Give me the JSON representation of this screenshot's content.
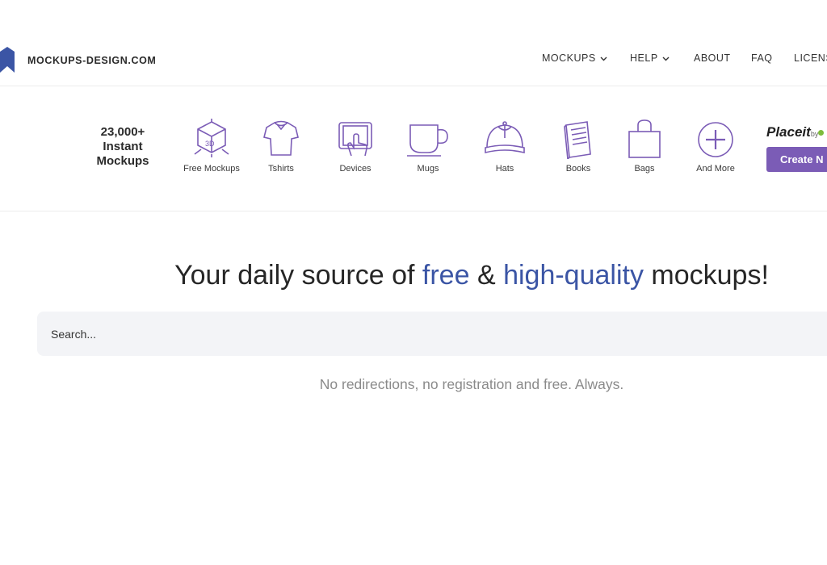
{
  "brand": {
    "name": "MOCKUPS-DESIGN.COM",
    "color": "#3b55a5"
  },
  "nav": [
    {
      "label": "MOCKUPS",
      "has_dropdown": true
    },
    {
      "label": "HELP",
      "has_dropdown": true
    },
    {
      "label": "ABOUT",
      "has_dropdown": false
    },
    {
      "label": "FAQ",
      "has_dropdown": false
    },
    {
      "label": "LICENS",
      "has_dropdown": false
    }
  ],
  "promo": {
    "count": "23,000+",
    "line2": "Instant",
    "line3": "Mockups"
  },
  "categories": [
    {
      "label": "Free Mockups",
      "icon": "cube-3d-icon"
    },
    {
      "label": "Tshirts",
      "icon": "tshirt-icon"
    },
    {
      "label": "Devices",
      "icon": "tablet-hand-icon"
    },
    {
      "label": "Mugs",
      "icon": "mug-icon"
    },
    {
      "label": "Hats",
      "icon": "cap-icon"
    },
    {
      "label": "Books",
      "icon": "book-icon"
    },
    {
      "label": "Bags",
      "icon": "bag-icon"
    },
    {
      "label": "And More",
      "icon": "plus-circle-icon"
    }
  ],
  "placeit": {
    "logo": "Placeit",
    "by": "by",
    "button_label": "Create N",
    "button_color": "#7b5cb6"
  },
  "hero": {
    "part1": "Your daily source of ",
    "highlight1": "free",
    "part2": " & ",
    "highlight2": "high-quality",
    "part3": " mockups!",
    "highlight_color": "#3b55a5"
  },
  "search": {
    "placeholder": "Search..."
  },
  "tagline": "No redirections, no registration and free. Always.",
  "icon_color": "#7b5cb6"
}
